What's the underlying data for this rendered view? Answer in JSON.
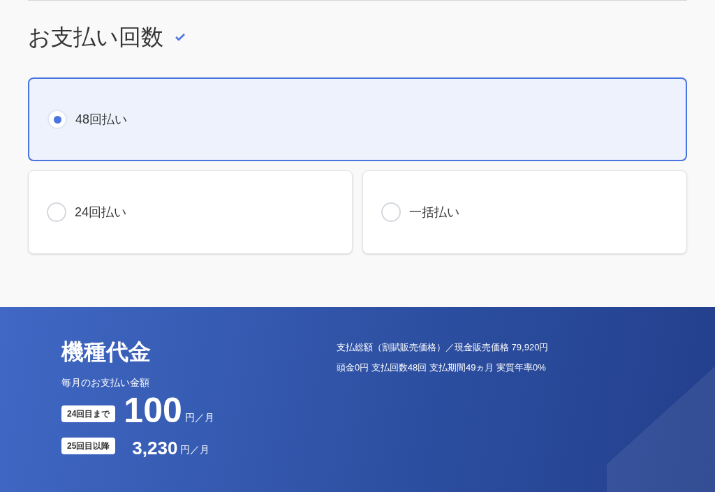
{
  "section": {
    "title": "お支払い回数",
    "completed": true
  },
  "options": [
    {
      "label": "48回払い",
      "selected": true
    },
    {
      "label": "24回払い",
      "selected": false
    },
    {
      "label": "一括払い",
      "selected": false
    }
  ],
  "summary": {
    "title": "機種代金",
    "subtitle": "毎月のお支払い金額",
    "prices": [
      {
        "badge": "24回目まで",
        "amount": "100",
        "unit": "円／月",
        "kind": "large"
      },
      {
        "badge": "25回目以降",
        "amount": "3,230",
        "unit": "円／月",
        "kind": "small"
      }
    ],
    "notes": [
      "支払総額（割賦販売価格）／現金販売価格 79,920円",
      "頭金0円 支払回数48回 支払期間49ヵ月 実質年率0%"
    ]
  }
}
